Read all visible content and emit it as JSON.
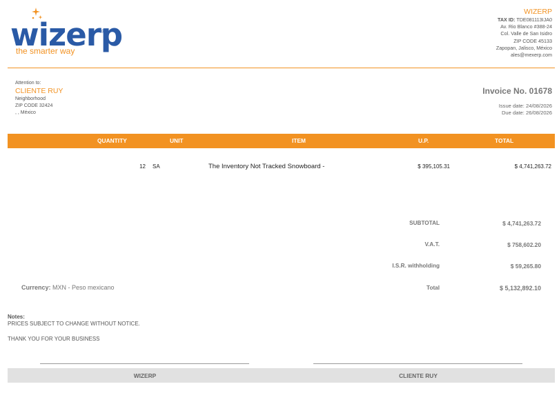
{
  "brand": {
    "logo_word": "wizerp",
    "logo_reg": "®",
    "tagline": "the smarter way",
    "accent": "#f29222",
    "blue": "#2a5aa6"
  },
  "company": {
    "name": "WIZERP",
    "tax_label": "TAX ID:",
    "tax_id": "TDE081113IJA0",
    "address1": "Av. Rio Blanco #388-24",
    "address2": "Col. Valle de San Isidro",
    "zip": "ZIP CODE 45133",
    "city": "Zapopan, Jalisco, México",
    "email": "ales@mexerp.com"
  },
  "client": {
    "attention": "Attention to:",
    "name": "CLIENTE RUY",
    "line1": "Neighborhood",
    "zip": "ZIP CODE 32424",
    "country": ", , México"
  },
  "invoice": {
    "title": "Invoice No. 01678",
    "issue_date": "Issue date: 24/08/2026",
    "due_date": "Due date: 26/08/2026"
  },
  "table": {
    "headers": [
      "QUANTITY",
      "UNIT",
      "ITEM",
      "U.P.",
      "TOTAL"
    ],
    "rows": [
      {
        "quantity": "12",
        "unit": "SA",
        "item": "The Inventory Not Tracked Snowboard -",
        "unit_price": "$ 395,105.31",
        "total": "$ 4,741,263.72"
      }
    ]
  },
  "totals": {
    "subtotal_label": "SUBTOTAL",
    "subtotal": "$ 4,741,263.72",
    "vat_label": "V.A.T.",
    "vat": "$ 758,602.20",
    "isr_label": "I.S.R. withholding",
    "isr": "$ 59,265.80",
    "total_label": "Total",
    "total": "$ 5,132,892.10"
  },
  "currency": {
    "label": "Currency:",
    "value": "MXN - Peso mexicano"
  },
  "notes": {
    "label": "Notes:",
    "line1": "PRICES SUBJECT TO CHANGE WITHOUT NOTICE.",
    "line2": "THANK YOU FOR YOUR BUSINESS"
  },
  "signatures": {
    "left": "WIZERP",
    "right": "CLIENTE RUY"
  }
}
